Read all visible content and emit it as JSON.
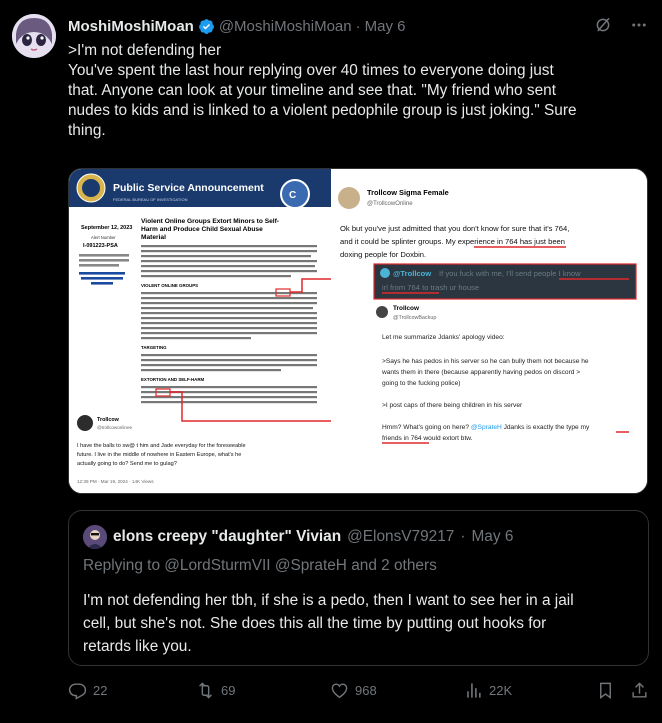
{
  "tweet": {
    "author_name": "MoshiMoshiMoan",
    "author_handle": "@MoshiMoshiMoan",
    "separator": "·",
    "date": "May 6",
    "lines": [
      ">I'm not defending her",
      "You've spent the last hour replying over 40 times to everyone doing just",
      "that.  Anyone can look at your timeline and see that.  \"My friend who sent",
      "nudes to kids and is linked to a violent pedophile group is just joking.\"  Sure",
      "thing."
    ]
  },
  "media": {
    "left": {
      "banner_title": "Public Service Announcement",
      "banner_sub": "FEDERAL BUREAU OF INVESTIGATION",
      "date": "September 12, 2023",
      "alert_label": "Alert Number",
      "alert_number": "I-091223-PSA",
      "side_text": "Questions regarding this PSA should be directed to your local FBI Field Office.",
      "side_link_label": "Local Field Office Locations:",
      "side_link": "www.fbi.gov/contact-us/field-offices",
      "headline": "Violent Online Groups Extort Minors to Self-Harm and Produce Child Sexual Abuse Material",
      "section1": "VIOLENT ONLINE GROUPS",
      "section2": "TARGETING",
      "section3": "EXTORTION AND SELF-HARM",
      "tweet_name": "Trollcow",
      "tweet_handle": "@trollcowonlinee",
      "tweet_text": "I have the balls to sw@ t him and Jade everyday for the foreseeable future. I live in the middle of nowhere in Eastern Europe, what's he actually going to do? Send me to gulag?",
      "tweet_meta": "12:39 PM · Mar 19, 2024 · 14K Views"
    },
    "right": {
      "account_name": "Trollcow Sigma Female",
      "account_handle": "@TrollcowOnline",
      "text1": "Ok but you've just admitted that you don't know for sure that it's 764, and it could be splinter groups. My experience in 764 has just been doxing people for Doxbin.",
      "dark_handle": "@Trollcow",
      "dark_text": "If you fuck with me, I'll send people I know irl from 764 to trash ur house",
      "backup_name": "Trollcow",
      "backup_handle": "@TrollcowBackup",
      "text2": "Let me summarize Jdanks' apology video:",
      "text3": ">Says he has pedos in his server so he can bully them not because he wants them in there (because apparently having pedos on discord > going to the fucking police)",
      "text4": ">I post caps of there being children in his server",
      "text5": "Hmm? What's going on here? @SprateH Jdanks is exactly the type my friends in 764 would extort btw."
    }
  },
  "quote": {
    "author_name": "elons creepy \"daughter\" Vivian",
    "author_handle": "@ElonsV79217",
    "separator": "·",
    "date": "May 6",
    "replying_to": "Replying to @LordSturmVII @SprateH and 2 others",
    "lines": [
      "I'm not defending her tbh, if she is a pedo, then I want to see her in a jail",
      "cell, but she's not. She does this all the time by putting out hooks for",
      "retards like you."
    ]
  },
  "actions": {
    "replies": "22",
    "reposts": "69",
    "likes": "968",
    "views": "22K"
  },
  "colors": {
    "background": "#000000",
    "text": "#e7e9ea",
    "muted": "#71767b",
    "border": "#2f3336",
    "verified": "#1d9bf0",
    "red_highlight": "#e0282b"
  }
}
